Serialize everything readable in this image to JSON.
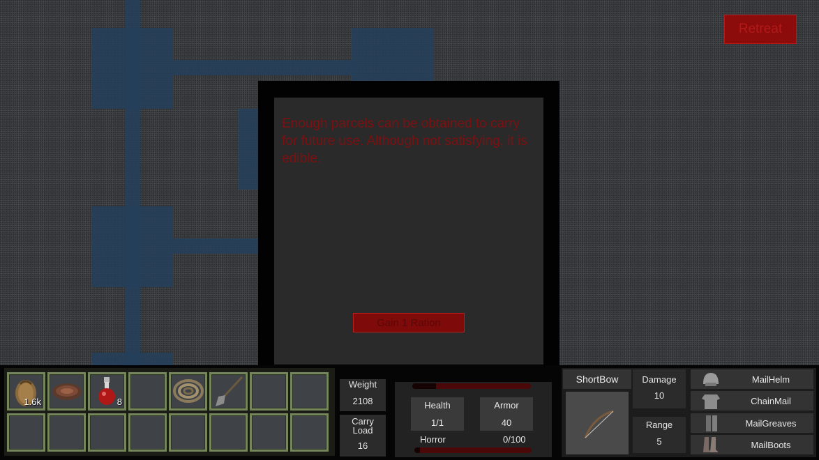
{
  "header": {
    "retreat_label": "Retreat"
  },
  "dialog": {
    "text": "Enough parcels can be obtained to carry for future use. Although not satisfying, it is edible.",
    "button_label": "Gain 1 Ration"
  },
  "inventory": {
    "slots": [
      {
        "icon": "grain-sack-icon",
        "count": "1.6k"
      },
      {
        "icon": "meat-icon",
        "count": ""
      },
      {
        "icon": "potion-icon",
        "count": "8"
      },
      {
        "icon": "",
        "count": ""
      },
      {
        "icon": "rope-icon",
        "count": ""
      },
      {
        "icon": "shovel-icon",
        "count": ""
      },
      {
        "icon": "",
        "count": ""
      },
      {
        "icon": "",
        "count": ""
      },
      {
        "icon": "",
        "count": ""
      },
      {
        "icon": "",
        "count": ""
      },
      {
        "icon": "",
        "count": ""
      },
      {
        "icon": "",
        "count": ""
      },
      {
        "icon": "",
        "count": ""
      },
      {
        "icon": "",
        "count": ""
      },
      {
        "icon": "",
        "count": ""
      },
      {
        "icon": "",
        "count": ""
      }
    ]
  },
  "load": {
    "weight_label": "Weight",
    "weight_value": "2108",
    "carry_label": "Carry Load",
    "carry_value": "16"
  },
  "status": {
    "health_label": "Health",
    "health_value": "1/1",
    "armor_label": "Armor",
    "armor_value": "40",
    "horror_label": "Horror",
    "horror_value": "0/100",
    "health_bar_fraction": 0.2,
    "horror_bar_fraction": 0.05
  },
  "weapon": {
    "name": "ShortBow",
    "icon": "bow-icon",
    "damage_label": "Damage",
    "damage_value": "10",
    "range_label": "Range",
    "range_value": "5"
  },
  "armor": {
    "items": [
      {
        "name": "MailHelm",
        "icon": "helmet-icon"
      },
      {
        "name": "ChainMail",
        "icon": "chainmail-icon"
      },
      {
        "name": "MailGreaves",
        "icon": "greaves-icon"
      },
      {
        "name": "MailBoots",
        "icon": "boots-icon"
      }
    ]
  },
  "colors": {
    "accent_red": "#8c0b0b",
    "dialog_text": "#7d1010",
    "map_room": "#25405c"
  }
}
